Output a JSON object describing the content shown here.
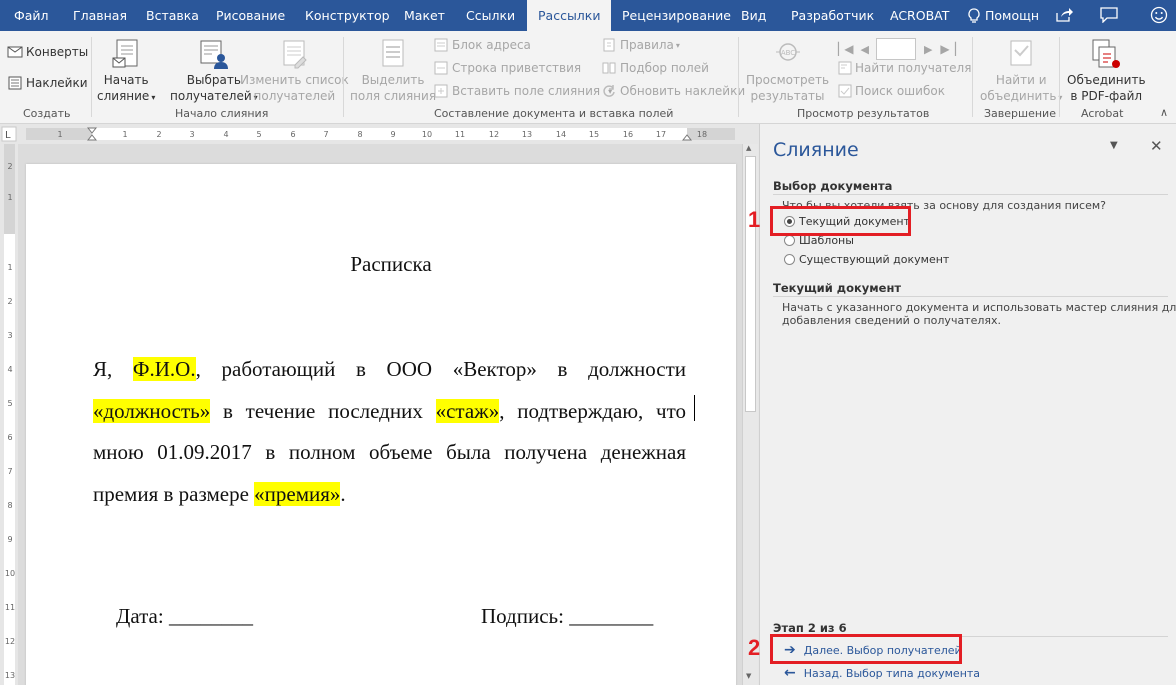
{
  "tabs": [
    "Файл",
    "Главная",
    "Вставка",
    "Рисование",
    "Конструктор",
    "Макет",
    "Ссылки",
    "Рассылки",
    "Рецензирование",
    "Вид",
    "Разработчик",
    "ACROBAT"
  ],
  "help_label": "Помощн",
  "ribbon": {
    "create": {
      "envelopes": "Конверты",
      "labels": "Наклейки",
      "group": "Создать"
    },
    "start": {
      "start_merge_1": "Начать",
      "start_merge_2": "слияние",
      "select_recipients_1": "Выбрать",
      "select_recipients_2": "получателей",
      "edit_list_1": "Изменить список",
      "edit_list_2": "получателей",
      "group": "Начало слияния"
    },
    "write": {
      "highlight_1": "Выделить",
      "highlight_2": "поля слияния",
      "address_block": "Блок адреса",
      "greeting_line": "Строка приветствия",
      "insert_field": "Вставить поле слияния",
      "rules": "Правила",
      "match_fields": "Подбор полей",
      "update_labels": "Обновить наклейки",
      "group": "Составление документа и вставка полей"
    },
    "preview": {
      "preview_1": "Просмотреть",
      "preview_2": "результаты",
      "find_recipient": "Найти получателя",
      "check_errors": "Поиск ошибок",
      "record_value": "",
      "group": "Просмотр результатов"
    },
    "finish": {
      "finish_1": "Найти и",
      "finish_2": "объединить",
      "group": "Завершение"
    },
    "acrobat": {
      "merge_pdf_1": "Объединить",
      "merge_pdf_2": "в PDF-файл",
      "group": "Acrobat"
    }
  },
  "document": {
    "title": "Расписка",
    "p_1": "Я, ",
    "field_fio": "Ф.И.О.",
    "p_2": ", работающий в ООО «Вектор» в должности ",
    "field_position": "«должность»",
    "p_3": " в течение последних ",
    "field_tenure": "«стаж»",
    "p_4": ", подтверждаю, что мною 01.09.2017 в полном объеме была получена денежная премия в размере ",
    "field_bonus": "«премия»",
    "p_5": ".",
    "date_line": "Дата: ________",
    "signature_line": "Подпись: ________"
  },
  "pane": {
    "title": "Слияние",
    "section_select": "Выбор документа",
    "question": "Что бы вы хотели взять за основу для создания писем?",
    "options": [
      "Текущий документ",
      "Шаблоны",
      "Существующий документ"
    ],
    "selected_option": "Текущий документ",
    "section_current": "Текущий документ",
    "desc_1": "Начать с указанного документа и использовать мастер слияния для",
    "desc_2": "добавления сведений о получателях.",
    "step": "Этап 2 из 6",
    "next_link": "Далее. Выбор получателей",
    "back_link": "Назад. Выбор типа документа"
  },
  "annotations": {
    "marker_1": "1",
    "marker_2": "2"
  },
  "colors": {
    "accent": "#2b579a",
    "highlight": "#ffff00",
    "annotation": "#e31e24"
  }
}
